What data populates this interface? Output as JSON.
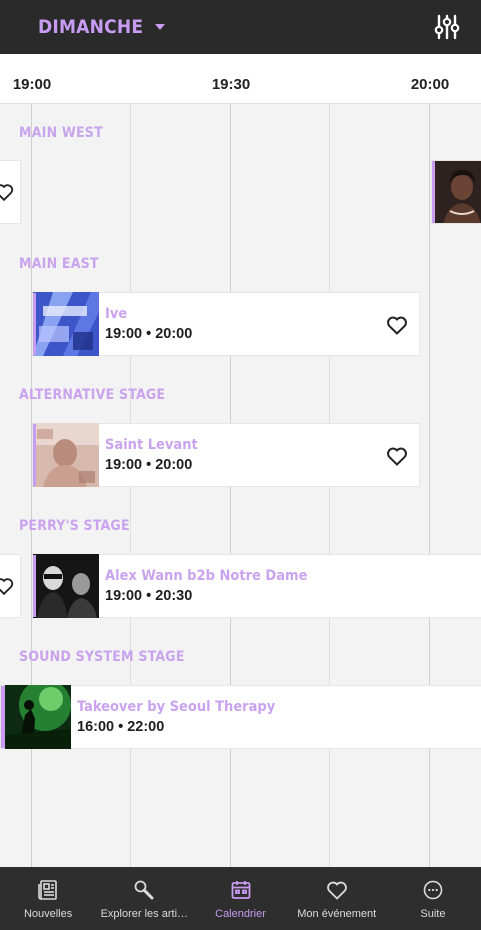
{
  "header": {
    "day": "DIMANCHE",
    "filter_icon": "sliders-icon"
  },
  "timeline": {
    "times": [
      "19:00",
      "19:30",
      "20:00"
    ]
  },
  "stages": [
    {
      "label": "MAIN WEST"
    },
    {
      "label": "MAIN EAST"
    },
    {
      "label": "ALTERNATIVE STAGE"
    },
    {
      "label": "PERRY'S STAGE"
    },
    {
      "label": "SOUND SYSTEM STAGE"
    }
  ],
  "performances": [
    {
      "artist": "Ive",
      "time": "19:00 • 20:00",
      "stage": "MAIN EAST"
    },
    {
      "artist": "Saint Levant",
      "time": "19:00 • 20:00",
      "stage": "ALTERNATIVE STAGE"
    },
    {
      "artist": "Alex Wann b2b Notre Dame",
      "time": "19:00 • 20:30",
      "stage": "PERRY'S STAGE"
    },
    {
      "artist": "Takeover by Seoul Therapy",
      "time": "16:00 • 22:00",
      "stage": "SOUND SYSTEM STAGE"
    }
  ],
  "bottom_nav": [
    {
      "label": "Nouvelles",
      "icon": "newspaper-icon",
      "active": false
    },
    {
      "label": "Explorer les arti…",
      "icon": "search-icon",
      "active": false
    },
    {
      "label": "Calendrier",
      "icon": "calendar-icon",
      "active": true
    },
    {
      "label": "Mon événement",
      "icon": "heart-icon",
      "active": false
    },
    {
      "label": "Suite",
      "icon": "more-icon",
      "active": false
    }
  ],
  "colors": {
    "accent": "#c79cf2",
    "header_bg": "#2a2a2a",
    "nav_bg": "#2e2e2e"
  }
}
